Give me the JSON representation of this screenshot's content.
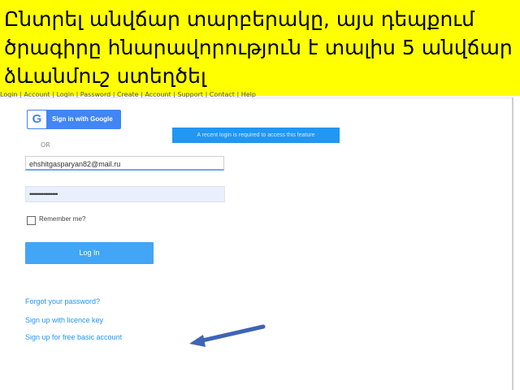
{
  "banner": {
    "text": "Ընտրել անվճար տարբերակը, այս դեպքում ծրագիրը հնարավորություն է տալիս 5 անվճար ձևանմուշ ստեղծել"
  },
  "header": {
    "breadcrumb": "Login | Account | Login | Password | Create | Account | Support | Contact | Help"
  },
  "login": {
    "google_label": "Sign in with Google",
    "google_logo": "G",
    "or_label": "OR",
    "email_value": "ehshitgasparyan82@mail.ru",
    "password_value": "••••••••••••••••",
    "remember_label": "Remember me?",
    "login_label": "Log In"
  },
  "notice": {
    "text": "A recent login is required to access this feature"
  },
  "links": {
    "forgot_password": "Forgot your password?",
    "signup_licence": "Sign up with licence key",
    "signup_free": "Sign up for free basic account"
  },
  "colors": {
    "banner_bg": "#ffff00",
    "google_blue": "#4285f4",
    "accent_blue": "#42a5f5",
    "link_blue": "#2196f3",
    "arrow_blue": "#3d64b6"
  },
  "icons": {
    "google": "google-logo-icon",
    "checkbox": "checkbox-icon",
    "arrow": "arrow-pointer-icon"
  }
}
